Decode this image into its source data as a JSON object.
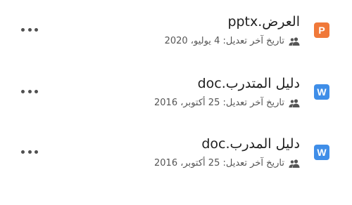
{
  "files": [
    {
      "icon_letter": "P",
      "icon_type": "powerpoint-icon",
      "icon_color": "#f0793a",
      "name": "العرض.pptx",
      "modified": "تاريخ آخر تعديل: 4 يوليو، 2020"
    },
    {
      "icon_letter": "W",
      "icon_type": "word-icon",
      "icon_color": "#3f8ee8",
      "name": "دليل المتدرب.doc",
      "modified": "تاريخ آخر تعديل: 25 أكتوبر، 2016"
    },
    {
      "icon_letter": "W",
      "icon_type": "word-icon",
      "icon_color": "#3f8ee8",
      "name": "دليل المدرب.doc",
      "modified": "تاريخ آخر تعديل: 25 أكتوبر، 2016"
    }
  ],
  "icons": {
    "shared": "shared-people-icon",
    "more": "more-options-icon"
  }
}
